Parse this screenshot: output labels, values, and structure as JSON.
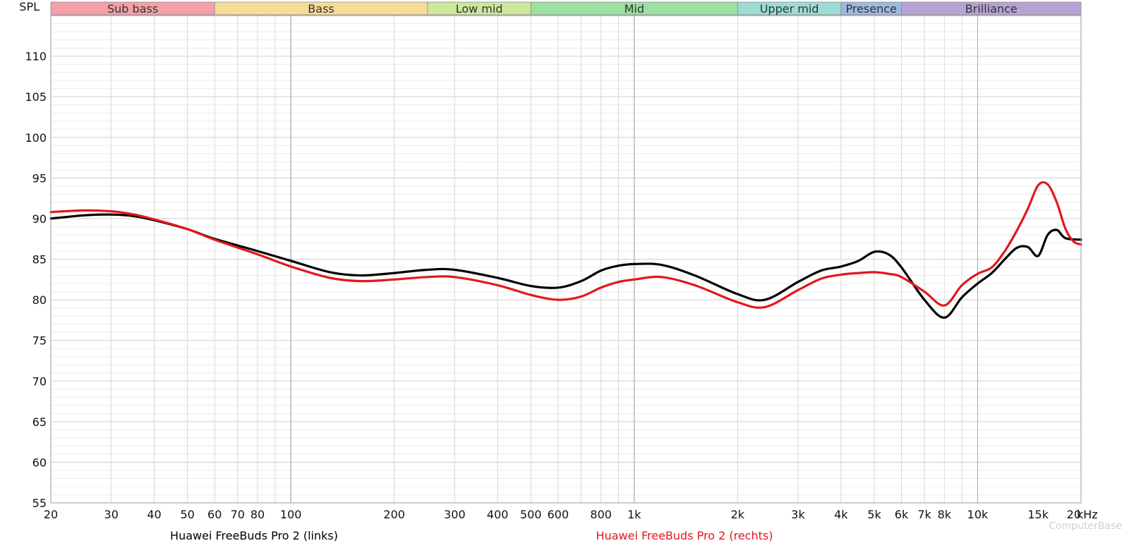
{
  "chart_data": {
    "type": "line",
    "ylabel": "SPL",
    "x_unit": "kHz",
    "xscale": "log",
    "xlim": [
      20,
      20000
    ],
    "ylim": [
      55,
      115
    ],
    "grid": true,
    "yticks": [
      55,
      60,
      65,
      70,
      75,
      80,
      85,
      90,
      95,
      100,
      105,
      110
    ],
    "xticks": [
      {
        "v": 20,
        "label": "20"
      },
      {
        "v": 30,
        "label": "30"
      },
      {
        "v": 40,
        "label": "40"
      },
      {
        "v": 50,
        "label": "50"
      },
      {
        "v": 60,
        "label": "60"
      },
      {
        "v": 70,
        "label": "70"
      },
      {
        "v": 80,
        "label": "80"
      },
      {
        "v": 100,
        "label": "100"
      },
      {
        "v": 200,
        "label": "200"
      },
      {
        "v": 300,
        "label": "300"
      },
      {
        "v": 400,
        "label": "400"
      },
      {
        "v": 500,
        "label": "500"
      },
      {
        "v": 600,
        "label": "600"
      },
      {
        "v": 800,
        "label": "800"
      },
      {
        "v": 1000,
        "label": "1k"
      },
      {
        "v": 2000,
        "label": "2k"
      },
      {
        "v": 3000,
        "label": "3k"
      },
      {
        "v": 4000,
        "label": "4k"
      },
      {
        "v": 5000,
        "label": "5k"
      },
      {
        "v": 6000,
        "label": "6k"
      },
      {
        "v": 7000,
        "label": "7k"
      },
      {
        "v": 8000,
        "label": "8k"
      },
      {
        "v": 10000,
        "label": "10k"
      },
      {
        "v": 15000,
        "label": "15k"
      },
      {
        "v": 20000,
        "label": "20"
      }
    ],
    "bands": [
      {
        "name": "Sub bass",
        "from": 20,
        "to": 60,
        "color": "#f4a0a8"
      },
      {
        "name": "Bass",
        "from": 60,
        "to": 250,
        "color": "#f6dc98"
      },
      {
        "name": "Low mid",
        "from": 250,
        "to": 500,
        "color": "#cde79b"
      },
      {
        "name": "Mid",
        "from": 500,
        "to": 2000,
        "color": "#9edfa2"
      },
      {
        "name": "Upper mid",
        "from": 2000,
        "to": 4000,
        "color": "#9ddbd6"
      },
      {
        "name": "Presence",
        "from": 4000,
        "to": 6000,
        "color": "#9fb8df"
      },
      {
        "name": "Brilliance",
        "from": 6000,
        "to": 20000,
        "color": "#b7a3d3"
      }
    ],
    "series": [
      {
        "name": "Huawei FreeBuds Pro 2 (links)",
        "color": "#000000",
        "x": [
          20,
          25,
          30,
          35,
          40,
          50,
          60,
          80,
          100,
          130,
          160,
          200,
          250,
          300,
          400,
          500,
          600,
          700,
          800,
          900,
          1000,
          1200,
          1500,
          2000,
          2400,
          3000,
          3500,
          4000,
          4500,
          5000,
          5500,
          6000,
          7000,
          8000,
          9000,
          10000,
          11000,
          12000,
          13000,
          14000,
          15000,
          16000,
          17000,
          18000,
          20000
        ],
        "y": [
          90.0,
          90.4,
          90.5,
          90.3,
          89.8,
          88.7,
          87.5,
          86.0,
          84.8,
          83.4,
          83.0,
          83.3,
          83.7,
          83.7,
          82.7,
          81.7,
          81.5,
          82.3,
          83.6,
          84.2,
          84.4,
          84.3,
          83.0,
          80.7,
          80.0,
          82.2,
          83.6,
          84.1,
          84.8,
          85.9,
          85.6,
          84.0,
          80.0,
          77.8,
          80.3,
          82.0,
          83.3,
          85.0,
          86.4,
          86.5,
          85.4,
          88.0,
          88.6,
          87.6,
          87.4
        ]
      },
      {
        "name": "Huawei FreeBuds Pro 2 (rechts)",
        "color": "#e3171e",
        "x": [
          20,
          25,
          30,
          35,
          40,
          50,
          60,
          80,
          100,
          130,
          160,
          200,
          250,
          300,
          400,
          500,
          600,
          700,
          800,
          900,
          1000,
          1200,
          1500,
          2000,
          2400,
          3000,
          3500,
          4000,
          4500,
          5000,
          5500,
          6000,
          7000,
          8000,
          9000,
          10000,
          11000,
          12000,
          13000,
          14000,
          15000,
          16000,
          17000,
          18000,
          19000,
          20000
        ],
        "y": [
          90.8,
          91.0,
          90.9,
          90.5,
          89.9,
          88.7,
          87.4,
          85.6,
          84.1,
          82.7,
          82.3,
          82.5,
          82.8,
          82.8,
          81.8,
          80.6,
          80.0,
          80.4,
          81.5,
          82.2,
          82.5,
          82.8,
          81.8,
          79.7,
          79.1,
          81.2,
          82.6,
          83.1,
          83.3,
          83.4,
          83.2,
          82.8,
          81.0,
          79.3,
          81.8,
          83.2,
          84.0,
          86.0,
          88.5,
          91.2,
          94.1,
          94.2,
          92.0,
          88.8,
          87.2,
          86.8
        ]
      }
    ]
  },
  "watermark": "ComputerBase"
}
